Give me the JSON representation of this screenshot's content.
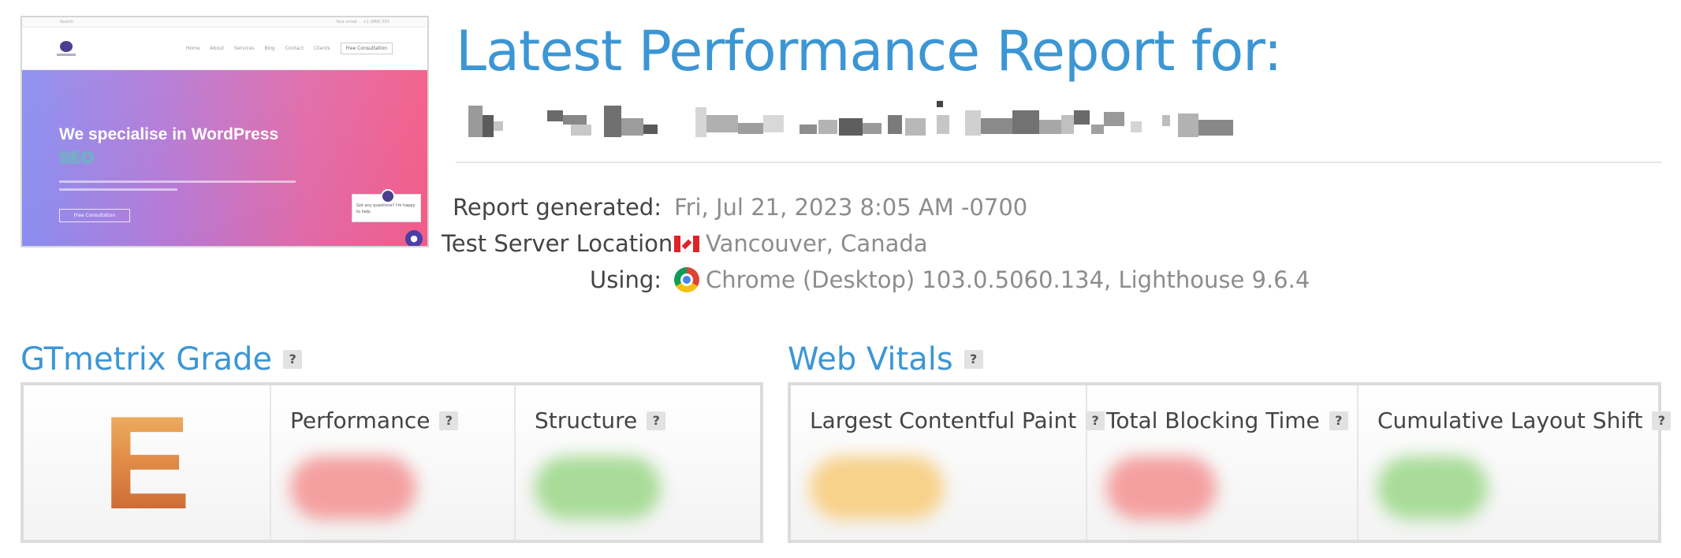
{
  "thumbnail": {
    "topbar_search": "Search",
    "topbar_email": "Your email",
    "topbar_phone": "+1 (888) 555",
    "nav": [
      "Home",
      "About",
      "Services",
      "Blog",
      "Contact",
      "Clients"
    ],
    "nav_cta": "Free Consultation",
    "hero_heading": "We specialise in WordPress",
    "hero_subheading": "SEO",
    "hero_button": "Free Consultation",
    "chat_text": "Got any questions? I'm happy to help."
  },
  "header": {
    "title": "Latest Performance Report for:"
  },
  "meta": {
    "report_generated_label": "Report generated:",
    "report_generated_value": "Fri, Jul 21, 2023 8:05 AM -0700",
    "location_label": "Test Server Location:",
    "location_value": "Vancouver, Canada",
    "using_label": "Using:",
    "using_value": "Chrome (Desktop) 103.0.5060.134, Lighthouse 9.6.4"
  },
  "gtmetrix": {
    "title": "GTmetrix Grade",
    "help": "?",
    "grade": "E",
    "performance_label": "Performance",
    "structure_label": "Structure",
    "colors": {
      "performance": "#f28a8a",
      "structure": "#8fd27f"
    }
  },
  "web_vitals": {
    "title": "Web Vitals",
    "help": "?",
    "lcp_label": "Largest Contentful Paint",
    "tbt_label": "Total Blocking Time",
    "cls_label": "Cumulative Layout Shift",
    "colors": {
      "lcp": "#f6c66b",
      "tbt": "#f28a8a",
      "cls": "#8fd27f"
    }
  }
}
